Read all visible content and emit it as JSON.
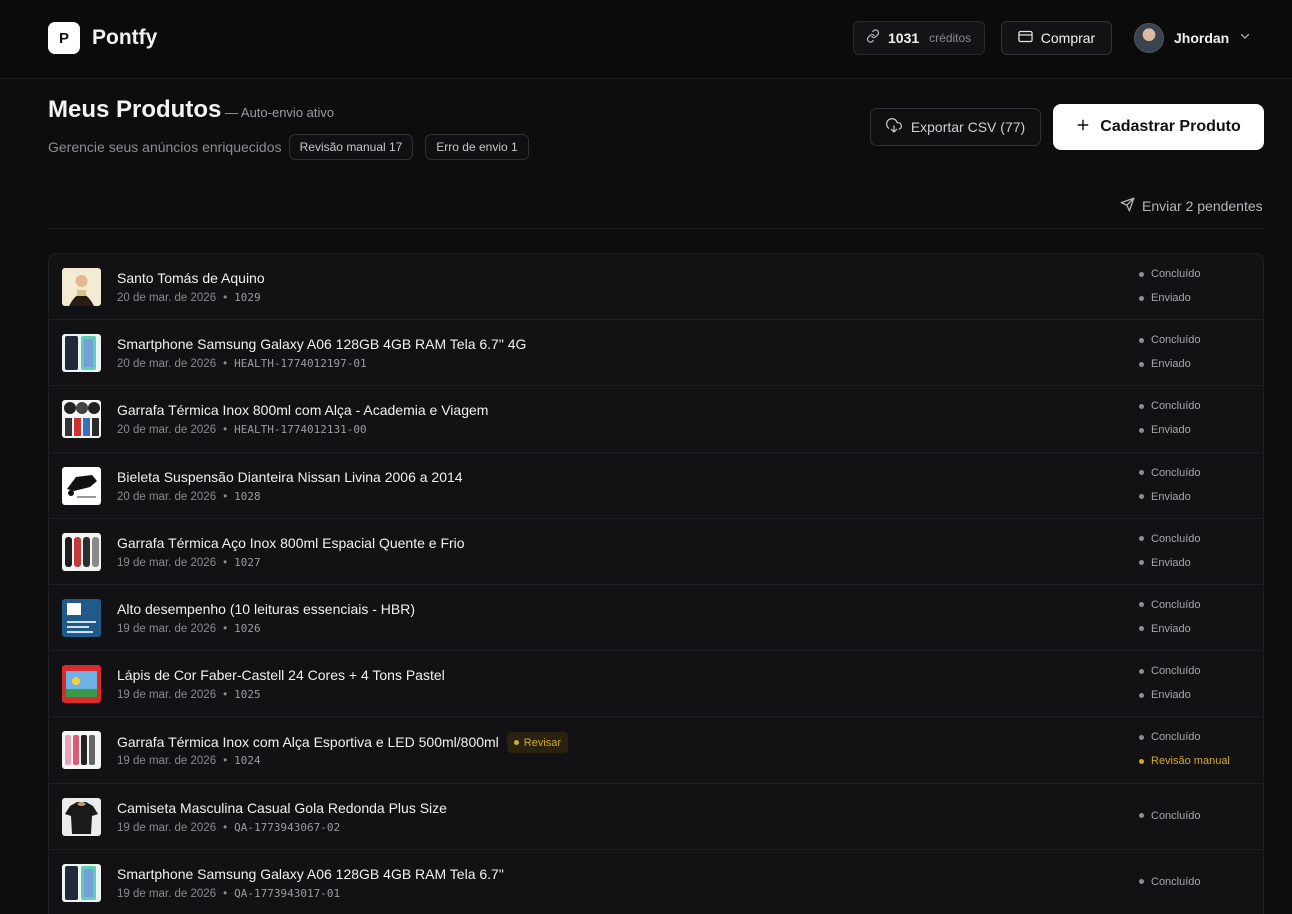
{
  "header": {
    "logo_letter": "P",
    "brand": "Pontfy",
    "credits_value": "1031",
    "credits_label": "créditos",
    "buy_label": "Comprar",
    "user_name": "Jhordan"
  },
  "page": {
    "title": "Meus Produtos",
    "auto_send": "— Auto-envio ativo",
    "subtitle": "Gerencie seus anúncios enriquecidos",
    "chip_review": "Revisão manual 17",
    "chip_error": "Erro de envio 1",
    "export_label": "Exportar CSV (77)",
    "new_product_label": "Cadastrar Produto",
    "send_pending_label": "Enviar 2 pendentes"
  },
  "products": [
    {
      "name": "Santo Tomás de Aquino",
      "date": "20 de mar. de 2026",
      "code": "1029",
      "status1": "Concluído",
      "status2": "Enviado"
    },
    {
      "name": "Smartphone Samsung Galaxy A06 128GB 4GB RAM Tela 6.7\" 4G",
      "date": "20 de mar. de 2026",
      "code": "HEALTH-1774012197-01",
      "status1": "Concluído",
      "status2": "Enviado"
    },
    {
      "name": "Garrafa Térmica Inox 800ml com Alça - Academia e Viagem",
      "date": "20 de mar. de 2026",
      "code": "HEALTH-1774012131-00",
      "status1": "Concluído",
      "status2": "Enviado"
    },
    {
      "name": "Bieleta Suspensão Dianteira Nissan Livina 2006 a 2014",
      "date": "20 de mar. de 2026",
      "code": "1028",
      "status1": "Concluído",
      "status2": "Enviado"
    },
    {
      "name": "Garrafa Térmica Aço Inox 800ml Espacial Quente e Frio",
      "date": "19 de mar. de 2026",
      "code": "1027",
      "status1": "Concluído",
      "status2": "Enviado"
    },
    {
      "name": "Alto desempenho (10 leituras essenciais - HBR)",
      "date": "19 de mar. de 2026",
      "code": "1026",
      "status1": "Concluído",
      "status2": "Enviado"
    },
    {
      "name": "Lápis de Cor Faber-Castell 24 Cores + 4 Tons Pastel",
      "date": "19 de mar. de 2026",
      "code": "1025",
      "status1": "Concluído",
      "status2": "Enviado"
    },
    {
      "name": "Garrafa Térmica Inox com Alça Esportiva e LED 500ml/800ml",
      "date": "19 de mar. de 2026",
      "code": "1024",
      "badge": "Revisar",
      "status1": "Concluído",
      "status2": "Revisão manual"
    },
    {
      "name": "Camiseta Masculina Casual Gola Redonda Plus Size",
      "date": "19 de mar. de 2026",
      "code": "QA-1773943067-02",
      "status1": "Concluído"
    },
    {
      "name": "Smartphone Samsung Galaxy A06 128GB 4GB RAM Tela 6.7\"",
      "date": "19 de mar. de 2026",
      "code": "QA-1773943017-01",
      "status1": "Concluído"
    }
  ],
  "meta_separator": "•",
  "colors": {
    "background": "#0d0d0e",
    "warning": "#d4a72c",
    "primary_button": "#ffffff"
  }
}
